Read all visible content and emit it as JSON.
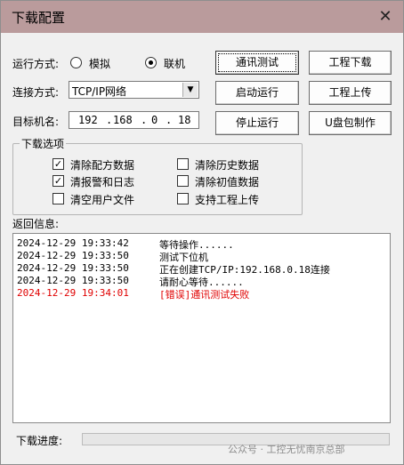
{
  "window": {
    "title": "下载配置",
    "close_glyph": "✕"
  },
  "run_mode": {
    "label": "运行方式:",
    "options": [
      {
        "label": "模拟",
        "selected": false
      },
      {
        "label": "联机",
        "selected": true
      }
    ]
  },
  "connect": {
    "label": "连接方式:",
    "value": "TCP/IP网络"
  },
  "target": {
    "label": "目标机名:",
    "ip": [
      "192",
      "168",
      "0",
      "18"
    ]
  },
  "buttons": {
    "comm_test": "通讯测试",
    "start_run": "启动运行",
    "stop_run": "停止运行",
    "project_download": "工程下载",
    "project_upload": "工程上传",
    "usb_make": "U盘包制作"
  },
  "download_options": {
    "title": "下载选项",
    "items": [
      {
        "label": "清除配方数据",
        "checked": true
      },
      {
        "label": "清除历史数据",
        "checked": false
      },
      {
        "label": "清报警和日志",
        "checked": true
      },
      {
        "label": "清除初值数据",
        "checked": false
      },
      {
        "label": "清空用户文件",
        "checked": false
      },
      {
        "label": "支持工程上传",
        "checked": false
      }
    ]
  },
  "log": {
    "label": "返回信息:",
    "rows": [
      {
        "time": "2024-12-29 19:33:42",
        "msg": "等待操作......",
        "color": "#000000"
      },
      {
        "time": "2024-12-29 19:33:50",
        "msg": "测试下位机",
        "color": "#000000"
      },
      {
        "time": "2024-12-29 19:33:50",
        "msg": "正在创建TCP/IP:192.168.0.18连接",
        "color": "#000000"
      },
      {
        "time": "2024-12-29 19:33:50",
        "msg": "请耐心等待......",
        "color": "#000000"
      },
      {
        "time": "2024-12-29 19:34:01",
        "msg": "[错误]通讯测试失败",
        "color": "#e00000"
      }
    ]
  },
  "progress": {
    "label": "下载进度:",
    "value": 0
  },
  "watermark": "公众号 · 工控无忧南京总部"
}
